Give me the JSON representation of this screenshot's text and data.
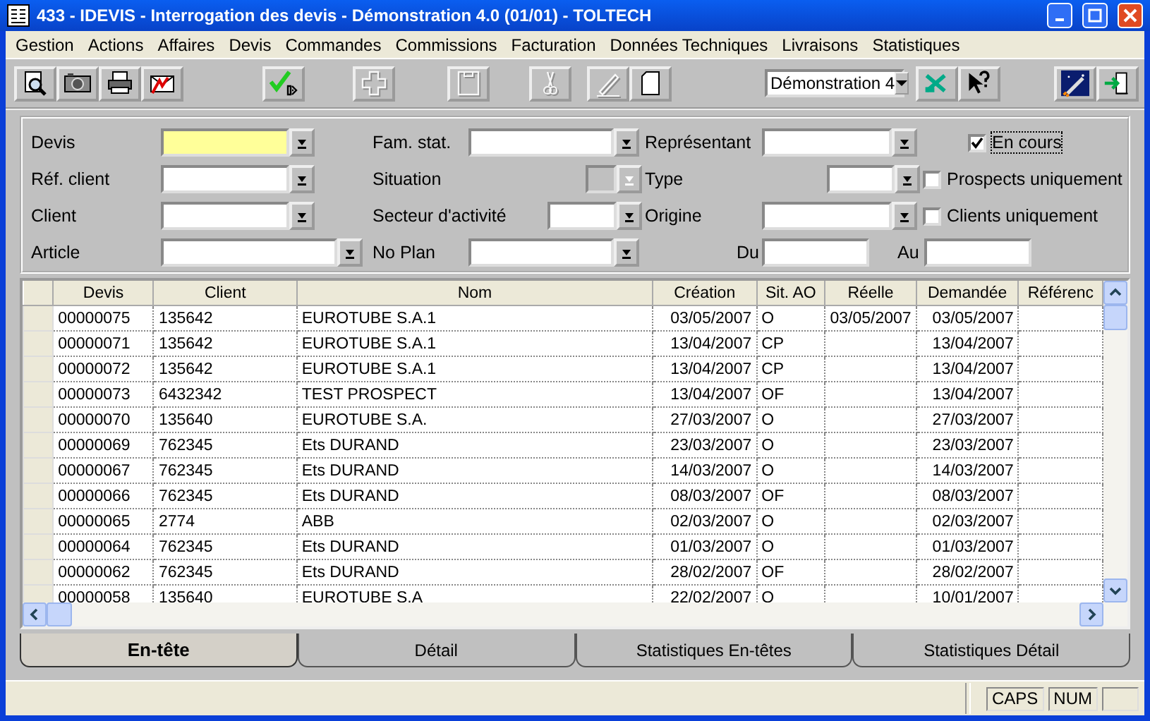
{
  "window": {
    "title": "433 - IDEVIS - Interrogation des devis - Démonstration 4.0 (01/01) - TOLTECH"
  },
  "menu": [
    "Gestion",
    "Actions",
    "Affaires",
    "Devis",
    "Commandes",
    "Commissions",
    "Facturation",
    "Données Techniques",
    "Livraisons",
    "Statistiques"
  ],
  "toolbar": {
    "buttons": [
      {
        "disabled": false
      },
      {
        "disabled": false
      },
      {
        "disabled": false
      },
      {
        "disabled": false
      },
      {
        "disabled": false
      },
      {
        "disabled": true
      },
      {
        "disabled": true
      },
      {
        "disabled": true
      },
      {
        "disabled": true
      },
      {
        "disabled": false
      }
    ],
    "company_select": {
      "value": "Démonstration 4"
    },
    "right_buttons": [
      {
        "disabled": false
      },
      {
        "disabled": false
      },
      {
        "disabled": false
      },
      {
        "disabled": false
      }
    ]
  },
  "filters": [
    [
      {
        "kind": "combo",
        "label": "Devis",
        "focused": true,
        "disabled": false
      },
      {
        "kind": "combo",
        "label": "Fam. stat.",
        "focused": false,
        "disabled": false
      },
      {
        "kind": "combo",
        "label": "Représentant",
        "focused": false,
        "disabled": false
      },
      {
        "kind": "checkbox",
        "label": "En cours",
        "checked": true
      }
    ],
    [
      {
        "kind": "combo",
        "label": "Réf. client",
        "focused": false,
        "disabled": false
      },
      {
        "kind": "combo",
        "label": "Situation",
        "focused": false,
        "disabled": true
      },
      {
        "kind": "combo",
        "label": "Type",
        "focused": false,
        "disabled": false
      },
      {
        "kind": "checkbox",
        "label": "Prospects uniquement",
        "checked": false
      }
    ],
    [
      {
        "kind": "combo",
        "label": "Client",
        "focused": false,
        "disabled": false
      },
      {
        "kind": "combo",
        "label": "Secteur d'activité",
        "focused": false,
        "disabled": false
      },
      {
        "kind": "combo",
        "label": "Origine",
        "focused": false,
        "disabled": false
      },
      {
        "kind": "checkbox",
        "label": "Clients uniquement",
        "checked": false
      }
    ],
    [
      {
        "kind": "combo",
        "label": "Article",
        "focused": false,
        "disabled": false
      },
      {
        "kind": "combo",
        "label": "No Plan",
        "focused": false,
        "disabled": false
      },
      {
        "kind": "date",
        "label": "Du"
      },
      {
        "kind": "date",
        "label": "Au"
      }
    ]
  ],
  "table": {
    "columns": [
      "Devis",
      "Client",
      "Nom",
      "Création",
      "Sit. AO",
      "Réelle",
      "Demandée",
      "Référenc"
    ],
    "rows": [
      [
        "00000075",
        "135642",
        "EUROTUBE S.A.1",
        "03/05/2007",
        "O",
        "03/05/2007",
        "03/05/2007",
        ""
      ],
      [
        "00000071",
        "135642",
        "EUROTUBE S.A.1",
        "13/04/2007",
        "CP",
        "",
        "13/04/2007",
        ""
      ],
      [
        "00000072",
        "135642",
        "EUROTUBE S.A.1",
        "13/04/2007",
        "CP",
        "",
        "13/04/2007",
        ""
      ],
      [
        "00000073",
        "6432342",
        "TEST PROSPECT",
        "13/04/2007",
        "OF",
        "",
        "13/04/2007",
        ""
      ],
      [
        "00000070",
        "135640",
        "EUROTUBE S.A.",
        "27/03/2007",
        "O",
        "",
        "27/03/2007",
        ""
      ],
      [
        "00000069",
        "762345",
        "Ets DURAND",
        "23/03/2007",
        "O",
        "",
        "23/03/2007",
        ""
      ],
      [
        "00000067",
        "762345",
        "Ets DURAND",
        "14/03/2007",
        "O",
        "",
        "14/03/2007",
        ""
      ],
      [
        "00000066",
        "762345",
        "Ets DURAND",
        "08/03/2007",
        "OF",
        "",
        "08/03/2007",
        ""
      ],
      [
        "00000065",
        "2774",
        "ABB",
        "02/03/2007",
        "O",
        "",
        "02/03/2007",
        ""
      ],
      [
        "00000064",
        "762345",
        "Ets DURAND",
        "01/03/2007",
        "O",
        "",
        "01/03/2007",
        ""
      ],
      [
        "00000062",
        "762345",
        "Ets DURAND",
        "28/02/2007",
        "OF",
        "",
        "28/02/2007",
        ""
      ],
      [
        "00000058",
        "135640",
        "EUROTUBE S.A",
        "22/02/2007",
        "O",
        "",
        "10/01/2007",
        ""
      ]
    ]
  },
  "tabs": [
    {
      "label": "En-tête",
      "selected": true
    },
    {
      "label": "Détail",
      "selected": false
    },
    {
      "label": "Statistiques En-têtes",
      "selected": false
    },
    {
      "label": "Statistiques Détail",
      "selected": false
    }
  ],
  "status_bar": {
    "indicators": [
      "CAPS",
      "NUM"
    ]
  }
}
